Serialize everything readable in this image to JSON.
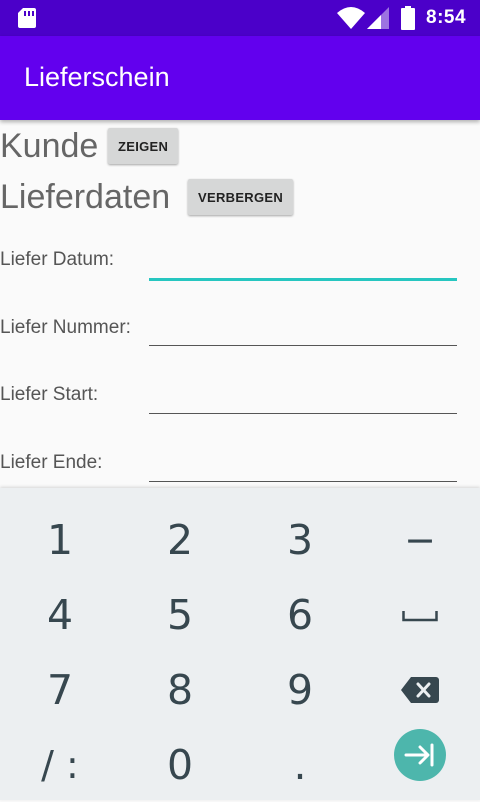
{
  "status_bar": {
    "time": "8:54"
  },
  "app_bar": {
    "title": "Lieferschein"
  },
  "sections": {
    "kunde": {
      "label": "Kunde",
      "button": "ZEIGEN"
    },
    "lieferdaten": {
      "label": "Lieferdaten",
      "button": "VERBERGEN"
    }
  },
  "fields": {
    "datum": {
      "label": "Liefer Datum:",
      "value": ""
    },
    "nummer": {
      "label": "Liefer Nummer:",
      "value": ""
    },
    "start": {
      "label": "Liefer Start:",
      "value": ""
    },
    "ende": {
      "label": "Liefer Ende:",
      "value": ""
    }
  },
  "keyboard": {
    "rows": [
      [
        "1",
        "2",
        "3",
        "−"
      ],
      [
        "4",
        "5",
        "6",
        "space"
      ],
      [
        "7",
        "8",
        "9",
        "backspace"
      ],
      [
        "/ :",
        "0",
        ".",
        "next"
      ]
    ]
  },
  "colors": {
    "status_bar": "#4b00c9",
    "app_bar": "#6200ee",
    "focus_underline": "#26c6c0",
    "next_key": "#4db6ac"
  }
}
